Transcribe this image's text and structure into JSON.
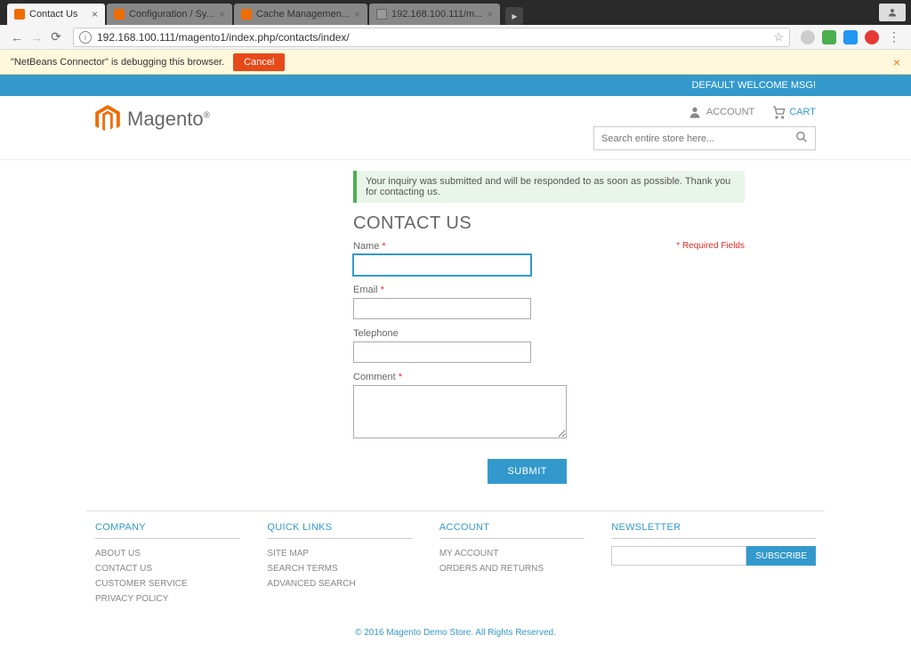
{
  "browser": {
    "tabs": [
      {
        "title": "Contact Us",
        "active": true,
        "favicon": "orange"
      },
      {
        "title": "Configuration / Sy...",
        "active": false,
        "favicon": "orange"
      },
      {
        "title": "Cache Managemen...",
        "active": false,
        "favicon": "orange"
      },
      {
        "title": "192.168.100.111/m...",
        "active": false,
        "favicon": "gray"
      }
    ],
    "url": "192.168.100.111/magento1/index.php/contacts/index/"
  },
  "debug": {
    "message": "\"NetBeans Connector\" is debugging this browser.",
    "cancel": "Cancel"
  },
  "header": {
    "welcome": "DEFAULT WELCOME MSG!",
    "brand": "Magento",
    "account_label": "ACCOUNT",
    "cart_label": "CART",
    "search_placeholder": "Search entire store here..."
  },
  "main": {
    "success_msg": "Your inquiry was submitted and will be responded to as soon as possible. Thank you for contacting us.",
    "title": "CONTACT US",
    "required_note": "Required Fields",
    "labels": {
      "name": "Name",
      "email": "Email",
      "telephone": "Telephone",
      "comment": "Comment"
    },
    "submit": "SUBMIT"
  },
  "footer": {
    "cols": {
      "company": {
        "title": "COMPANY",
        "links": [
          "ABOUT US",
          "CONTACT US",
          "CUSTOMER SERVICE",
          "PRIVACY POLICY"
        ]
      },
      "quick": {
        "title": "QUICK LINKS",
        "links": [
          "SITE MAP",
          "SEARCH TERMS",
          "ADVANCED SEARCH"
        ]
      },
      "account": {
        "title": "ACCOUNT",
        "links": [
          "MY ACCOUNT",
          "ORDERS AND RETURNS"
        ]
      },
      "newsletter": {
        "title": "NEWSLETTER",
        "subscribe": "SUBSCRIBE"
      }
    },
    "copyright": "© 2016 Magento Demo Store. All Rights Reserved."
  }
}
